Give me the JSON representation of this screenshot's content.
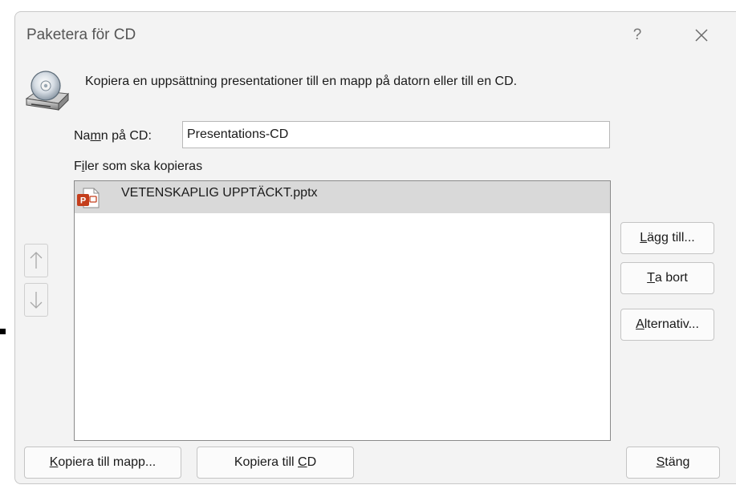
{
  "dialog": {
    "title": "Paketera för CD",
    "help_label": "?",
    "instruction": "Kopiera en uppsättning presentationer till en mapp på datorn eller till en CD.",
    "icons": {
      "help": "question-mark",
      "close": "close-x",
      "cd": "cd-drive-icon"
    }
  },
  "cd_name": {
    "label_pre": "Na",
    "label_accel": "m",
    "label_post": "n på CD:",
    "value": "Presentations-CD"
  },
  "files": {
    "label_pre": "F",
    "label_accel": "i",
    "label_post": "ler som ska kopieras",
    "items": [
      {
        "name": "VETENSKAPLIG UPPTÄCKT.pptx",
        "icon": "powerpoint-file-icon",
        "selected": true
      }
    ]
  },
  "reorder": {
    "up_icon": "arrow-up-icon",
    "down_icon": "arrow-down-icon"
  },
  "buttons": {
    "add": {
      "accel": "L",
      "rest": "ägg till..."
    },
    "remove": {
      "accel": "T",
      "rest": "a bort"
    },
    "options": {
      "accel": "A",
      "rest": "lternativ..."
    },
    "copy_folder": {
      "accel": "K",
      "rest": "opiera till mapp..."
    },
    "copy_cd": {
      "pre": "Kopiera till ",
      "accel": "C",
      "rest": "D"
    },
    "close": {
      "accel": "S",
      "rest": "täng"
    }
  },
  "colors": {
    "dialog_bg": "#f3f3f3",
    "selected_row": "#d9d9d9",
    "powerpoint_red": "#c43e1c"
  }
}
